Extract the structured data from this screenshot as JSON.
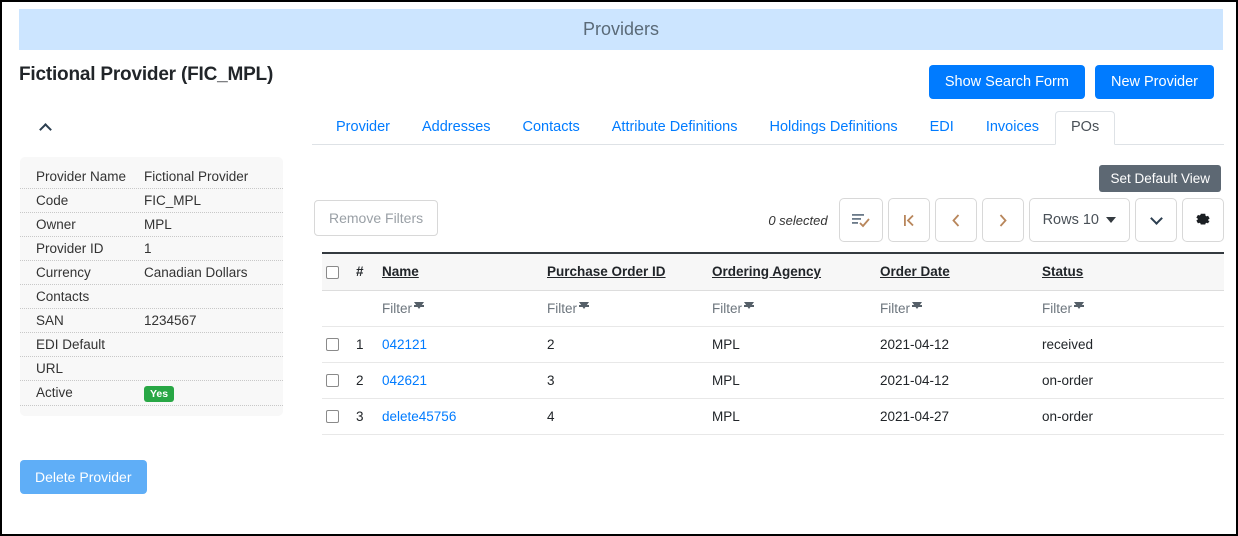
{
  "banner": {
    "title": "Providers"
  },
  "header": {
    "page_title": "Fictional Provider (FIC_MPL)",
    "show_search_form": "Show Search Form",
    "new_provider": "New Provider"
  },
  "sidebar": {
    "summary_rows": [
      {
        "label": "Provider Name",
        "value": "Fictional Provider"
      },
      {
        "label": "Code",
        "value": "FIC_MPL"
      },
      {
        "label": "Owner",
        "value": "MPL"
      },
      {
        "label": "Provider ID",
        "value": "1"
      },
      {
        "label": "Currency",
        "value": "Canadian Dollars"
      },
      {
        "label": "Contacts",
        "value": ""
      },
      {
        "label": "SAN",
        "value": "1234567"
      },
      {
        "label": "EDI Default",
        "value": ""
      },
      {
        "label": "URL",
        "value": ""
      },
      {
        "label": "Active",
        "value": "Yes",
        "badge": true
      }
    ],
    "delete_provider": "Delete Provider"
  },
  "tabs": [
    {
      "label": "Provider",
      "active": false
    },
    {
      "label": "Addresses",
      "active": false
    },
    {
      "label": "Contacts",
      "active": false
    },
    {
      "label": "Attribute Definitions",
      "active": false
    },
    {
      "label": "Holdings Definitions",
      "active": false
    },
    {
      "label": "EDI",
      "active": false
    },
    {
      "label": "Invoices",
      "active": false
    },
    {
      "label": "POs",
      "active": true
    }
  ],
  "tooltip": {
    "text": "Set Default View"
  },
  "toolbar": {
    "remove_filters": "Remove Filters",
    "selected_count": "0 selected",
    "columns_picker_icon": "column-picker-icon",
    "first_page_icon": "first-page-icon",
    "prev_page_icon": "previous-page-icon",
    "next_page_icon": "next-page-icon",
    "rows_label": "Rows 10",
    "more_icon": "chevron-down-icon",
    "settings_icon": "gear-icon"
  },
  "table": {
    "filter_label": "Filter",
    "columns": [
      {
        "key": "num",
        "label": "#"
      },
      {
        "key": "name",
        "label": "Name"
      },
      {
        "key": "po_id",
        "label": "Purchase Order ID"
      },
      {
        "key": "agency",
        "label": "Ordering Agency"
      },
      {
        "key": "order_date",
        "label": "Order Date"
      },
      {
        "key": "status",
        "label": "Status"
      }
    ],
    "rows": [
      {
        "num": "1",
        "name": "042121",
        "po_id": "2",
        "agency": "MPL",
        "order_date": "2021-04-12",
        "status": "received"
      },
      {
        "num": "2",
        "name": "042621",
        "po_id": "3",
        "agency": "MPL",
        "order_date": "2021-04-12",
        "status": "on-order"
      },
      {
        "num": "3",
        "name": "delete45756",
        "po_id": "4",
        "agency": "MPL",
        "order_date": "2021-04-27",
        "status": "on-order"
      }
    ]
  },
  "colors": {
    "banner_bg": "#cce5ff",
    "primary": "#007bff",
    "delete_button": "#5faef7",
    "badge_green": "#28a745",
    "tooltip_bg": "#5d6873",
    "arrow_icon": "#b8865b"
  }
}
